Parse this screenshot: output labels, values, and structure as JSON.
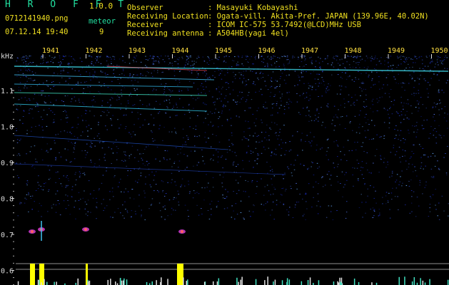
{
  "header": {
    "app_title": "H R O F F T",
    "version": "1.0.0",
    "filename": "0712141940.png",
    "datetime": "07.12.14 19:40",
    "meteor_label": "meteor",
    "meteor_count": "9",
    "info": [
      {
        "key": "Observer",
        "value": ": Masayuki Kobayashi"
      },
      {
        "key": "Receiving Location",
        "value": ": Ogata-vill. Akita-Pref. JAPAN (139.96E, 40.02N)"
      },
      {
        "key": "Receiver",
        "value": ": ICOM IC-575 53.7492(@LCD)MHz USB"
      },
      {
        "key": "Receiving antenna",
        "value": ": A504HB(yagi 4el)"
      }
    ]
  },
  "spectrogram": {
    "freq_unit": "kHz",
    "freq_ticks": [
      "1.1",
      "1.0",
      "0.9",
      "0.8",
      "0.7",
      "0.6"
    ],
    "time_ticks": [
      "1941",
      "1942",
      "1943",
      "1944",
      "1945",
      "1946",
      "1947",
      "1948",
      "1949",
      "1950"
    ]
  },
  "colors": {
    "background": "#000000",
    "header_green": "#22e0a0",
    "header_yellow": "#f0e020",
    "noise_blue": "#1a2aa0",
    "signal_cyan": "#40e0f0",
    "bar_yellow": "#ffff00"
  }
}
